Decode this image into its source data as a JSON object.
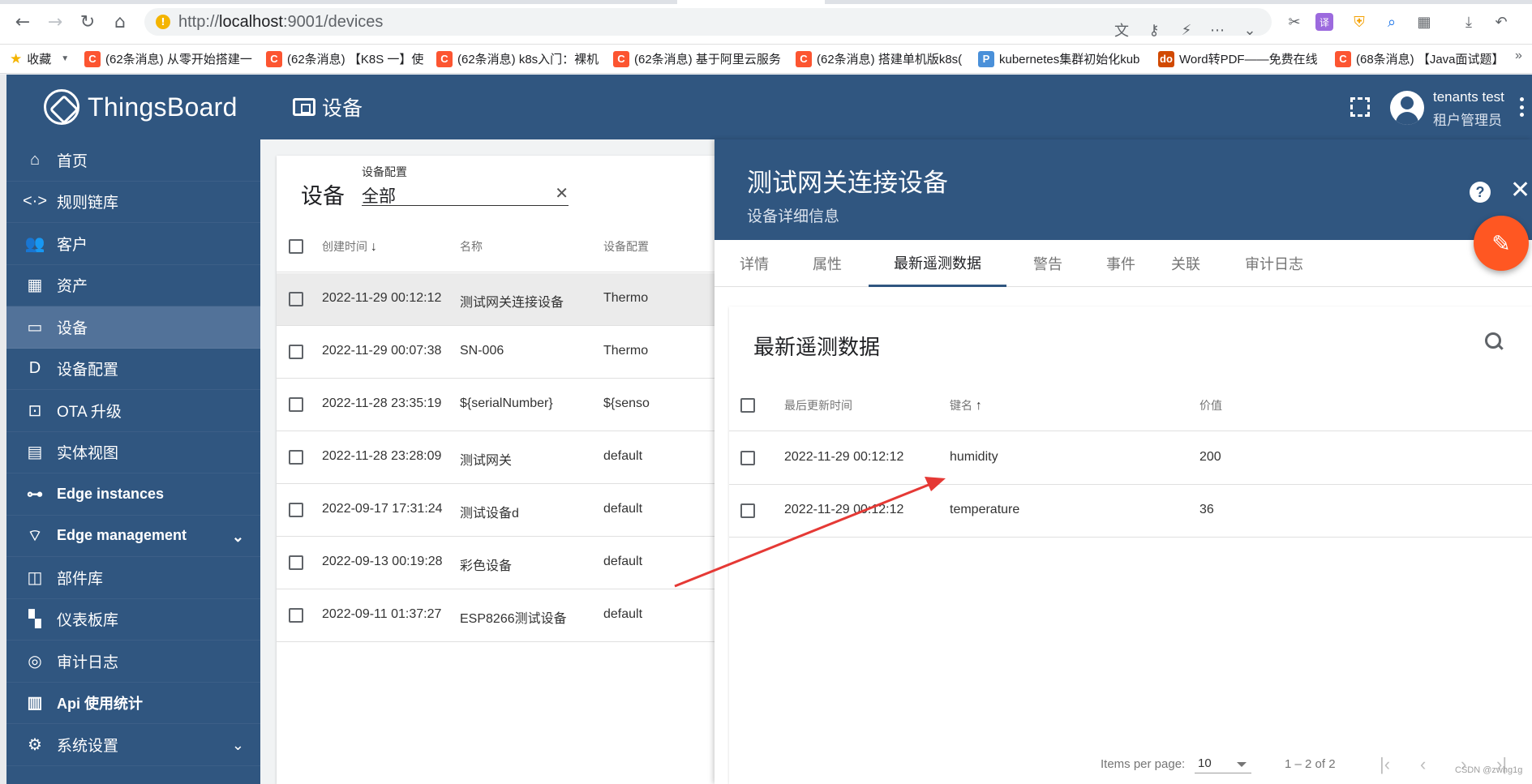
{
  "browser": {
    "url_scheme": "http://",
    "url_host": "localhost",
    "url_path": ":9001/devices",
    "bookmarks_label": "收藏",
    "bookmarks": [
      {
        "icon": "csdn-icon",
        "label": "(62条消息) 从零开始搭建一",
        "color": "#fc5531"
      },
      {
        "icon": "csdn-icon",
        "label": "(62条消息) 【K8S 一】使",
        "color": "#fc5531"
      },
      {
        "icon": "csdn-icon",
        "label": "(62条消息) k8s入门：裸机",
        "color": "#fc5531"
      },
      {
        "icon": "csdn-icon",
        "label": "(62条消息) 基于阿里云服务",
        "color": "#fc5531"
      },
      {
        "icon": "csdn-icon",
        "label": "(62条消息) 搭建单机版k8s(",
        "color": "#fc5531"
      },
      {
        "icon": "p-icon",
        "label": "kubernetes集群初始化kub",
        "color": "#4a90d9"
      },
      {
        "icon": "do-icon",
        "label": "Word转PDF——免费在线",
        "color": "#d14900"
      },
      {
        "icon": "csdn-icon",
        "label": "(68条消息) 【Java面试题】",
        "color": "#fc5531"
      }
    ]
  },
  "app": {
    "logo_text": "ThingsBoard",
    "header_title": "设备",
    "user_name": "tenants test",
    "user_role": "租户管理员"
  },
  "sidebar": {
    "items": [
      {
        "icon": "home-icon",
        "glyph": "⌂",
        "label": "首页"
      },
      {
        "icon": "rule-chain-icon",
        "glyph": "<·>",
        "label": "规则链库"
      },
      {
        "icon": "customers-icon",
        "glyph": "👥",
        "label": "客户"
      },
      {
        "icon": "assets-icon",
        "glyph": "▦",
        "label": "资产"
      },
      {
        "icon": "devices-icon",
        "glyph": "▭",
        "label": "设备"
      },
      {
        "icon": "device-profile-icon",
        "glyph": "D",
        "label": "设备配置"
      },
      {
        "icon": "ota-icon",
        "glyph": "⊡",
        "label": "OTA 升级"
      },
      {
        "icon": "entity-view-icon",
        "glyph": "▤",
        "label": "实体视图"
      },
      {
        "icon": "edge-icon",
        "glyph": "⊶",
        "label": "Edge instances"
      },
      {
        "icon": "edge-management-icon",
        "glyph": "⌔",
        "label": "Edge management"
      },
      {
        "icon": "widgets-icon",
        "glyph": "◫",
        "label": "部件库"
      },
      {
        "icon": "dashboard-icon",
        "glyph": "▚",
        "label": "仪表板库"
      },
      {
        "icon": "audit-log-icon",
        "glyph": "◎",
        "label": "审计日志"
      },
      {
        "icon": "api-usage-icon",
        "glyph": "▥",
        "label": "Api 使用统计"
      },
      {
        "icon": "settings-icon",
        "glyph": "⚙",
        "label": "系统设置"
      }
    ]
  },
  "device_list": {
    "title": "设备",
    "filter_label": "设备配置",
    "filter_value": "全部",
    "columns": {
      "created": "创建时间",
      "name": "名称",
      "profile": "设备配置"
    },
    "rows": [
      {
        "created": "2022-11-29 00:12:12",
        "name": "测试网关连接设备",
        "profile": "Thermo"
      },
      {
        "created": "2022-11-29 00:07:38",
        "name": "SN-006",
        "profile": "Thermo"
      },
      {
        "created": "2022-11-28 23:35:19",
        "name": "${serialNumber}",
        "profile": "${senso"
      },
      {
        "created": "2022-11-28 23:28:09",
        "name": "测试网关",
        "profile": "default"
      },
      {
        "created": "2022-09-17 17:31:24",
        "name": "测试设备d",
        "profile": "default"
      },
      {
        "created": "2022-09-13 00:19:28",
        "name": "彩色设备",
        "profile": "default"
      },
      {
        "created": "2022-09-11 01:37:27",
        "name": "ESP8266测试设备",
        "profile": "default"
      }
    ]
  },
  "detail": {
    "title": "测试网关连接设备",
    "subtitle": "设备详细信息",
    "tabs": [
      "详情",
      "属性",
      "最新遥测数据",
      "警告",
      "事件",
      "关联",
      "审计日志"
    ],
    "active_tab": "最新遥测数据",
    "telemetry": {
      "title": "最新遥测数据",
      "columns": {
        "updated": "最后更新时间",
        "key": "键名",
        "value": "价值"
      },
      "rows": [
        {
          "updated": "2022-11-29 00:12:12",
          "key": "humidity",
          "value": "200"
        },
        {
          "updated": "2022-11-29 00:12:12",
          "key": "temperature",
          "value": "36"
        }
      ]
    },
    "pager": {
      "items_per_page_label": "Items per page:",
      "items_per_page": "10",
      "range": "1 – 2 of 2"
    }
  },
  "watermark": "CSDN @zwhg1g",
  "colors": {
    "primary": "#305680",
    "sidebar_active": "#527299",
    "fab": "#ff5722",
    "annotation_arrow": "#e53935"
  }
}
